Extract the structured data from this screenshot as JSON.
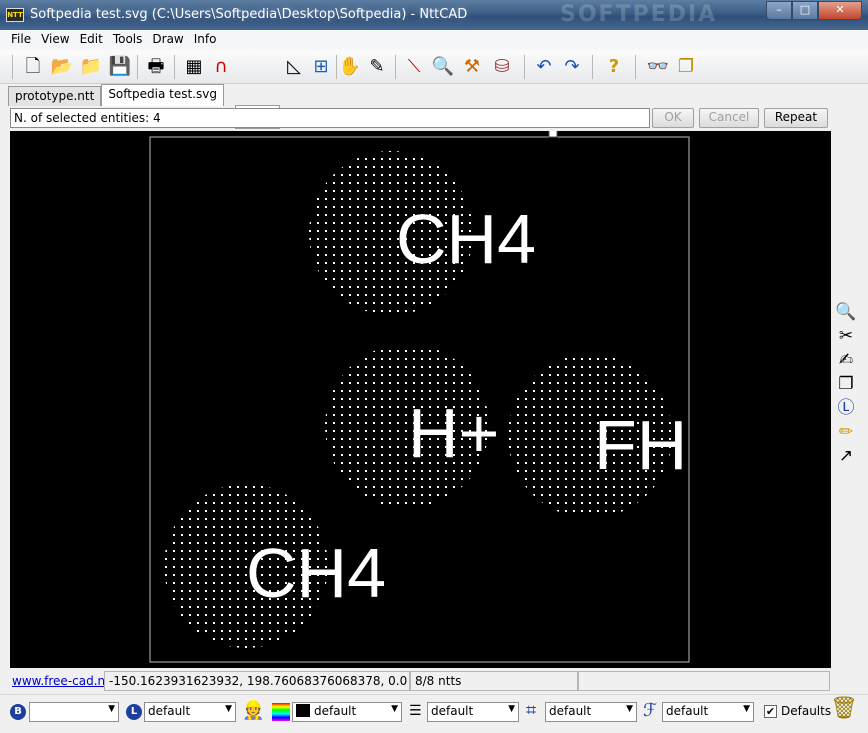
{
  "window": {
    "title": "Softpedia test.svg (C:\\Users\\Softpedia\\Desktop\\Softpedia) - NttCAD",
    "watermark": "SOFTPEDIA",
    "icon_label": "NTT",
    "min_glyph": "–",
    "max_glyph": "□",
    "close_glyph": "✕"
  },
  "menu": [
    "File",
    "View",
    "Edit",
    "Tools",
    "Draw",
    "Info"
  ],
  "toolbar": {
    "icons": [
      {
        "name": "new-file-icon",
        "glyph": "🗋"
      },
      {
        "name": "open-file-icon",
        "glyph": "📂"
      },
      {
        "name": "open-folder-icon",
        "glyph": "📁"
      },
      {
        "name": "save-icon",
        "glyph": "💾"
      },
      {
        "name": "print-icon",
        "glyph": "🖶"
      },
      {
        "name": "grid-icon",
        "glyph": "▦"
      },
      {
        "name": "snap-magnet-icon",
        "glyph": "∩"
      },
      {
        "name": "snap-line-icon",
        "glyph": "⟋"
      },
      {
        "name": "set-square-icon",
        "glyph": "◺"
      },
      {
        "name": "crosshair-icon",
        "glyph": "⊞"
      },
      {
        "name": "pan-hand-icon",
        "glyph": "✋"
      },
      {
        "name": "edit-pen-icon",
        "glyph": "✎"
      },
      {
        "name": "pick-icon",
        "glyph": "⟍"
      },
      {
        "name": "zoom-icon",
        "glyph": "🔍"
      },
      {
        "name": "measure-icon",
        "glyph": "⚒"
      },
      {
        "name": "layers-3d-icon",
        "glyph": "⛁"
      },
      {
        "name": "undo-icon",
        "glyph": "↶"
      },
      {
        "name": "redo-icon",
        "glyph": "↷"
      },
      {
        "name": "help-icon",
        "glyph": "?"
      },
      {
        "name": "glasses-icon",
        "glyph": "👓"
      },
      {
        "name": "windows-icon",
        "glyph": "❐"
      }
    ]
  },
  "tabs": [
    {
      "label": "prototype.ntt",
      "active": false
    },
    {
      "label": "Softpedia test.svg",
      "active": true
    }
  ],
  "command": {
    "text": "N. of selected entities: 4",
    "ok": "OK",
    "cancel": "Cancel",
    "repeat": "Repeat"
  },
  "drawing": {
    "labels": [
      "CH4",
      "H+",
      "FH",
      "CH4"
    ]
  },
  "right_tools": [
    {
      "name": "zoom-icon",
      "glyph": "🔍"
    },
    {
      "name": "scissors-icon",
      "glyph": "✂"
    },
    {
      "name": "draw-pen-icon",
      "glyph": "✍"
    },
    {
      "name": "copy-icon",
      "glyph": "❐"
    },
    {
      "name": "layer-icon",
      "glyph": "Ⓛ"
    },
    {
      "name": "pencil-icon",
      "glyph": "✏"
    },
    {
      "name": "dimension-icon",
      "glyph": "↗"
    }
  ],
  "status": {
    "link": "www.free-cad.net",
    "coords": "-150.1623931623932, 198.76068376068378, 0.0",
    "count": "8/8 ntts"
  },
  "properties": {
    "block_value": "",
    "layer_value": "default",
    "color_value": "default",
    "linetype_value": "default",
    "hatch_value": "default",
    "font_value": "default",
    "defaults_label": "Defaults",
    "defaults_checked": true,
    "block_letter": "B",
    "layer_letter": "L"
  }
}
